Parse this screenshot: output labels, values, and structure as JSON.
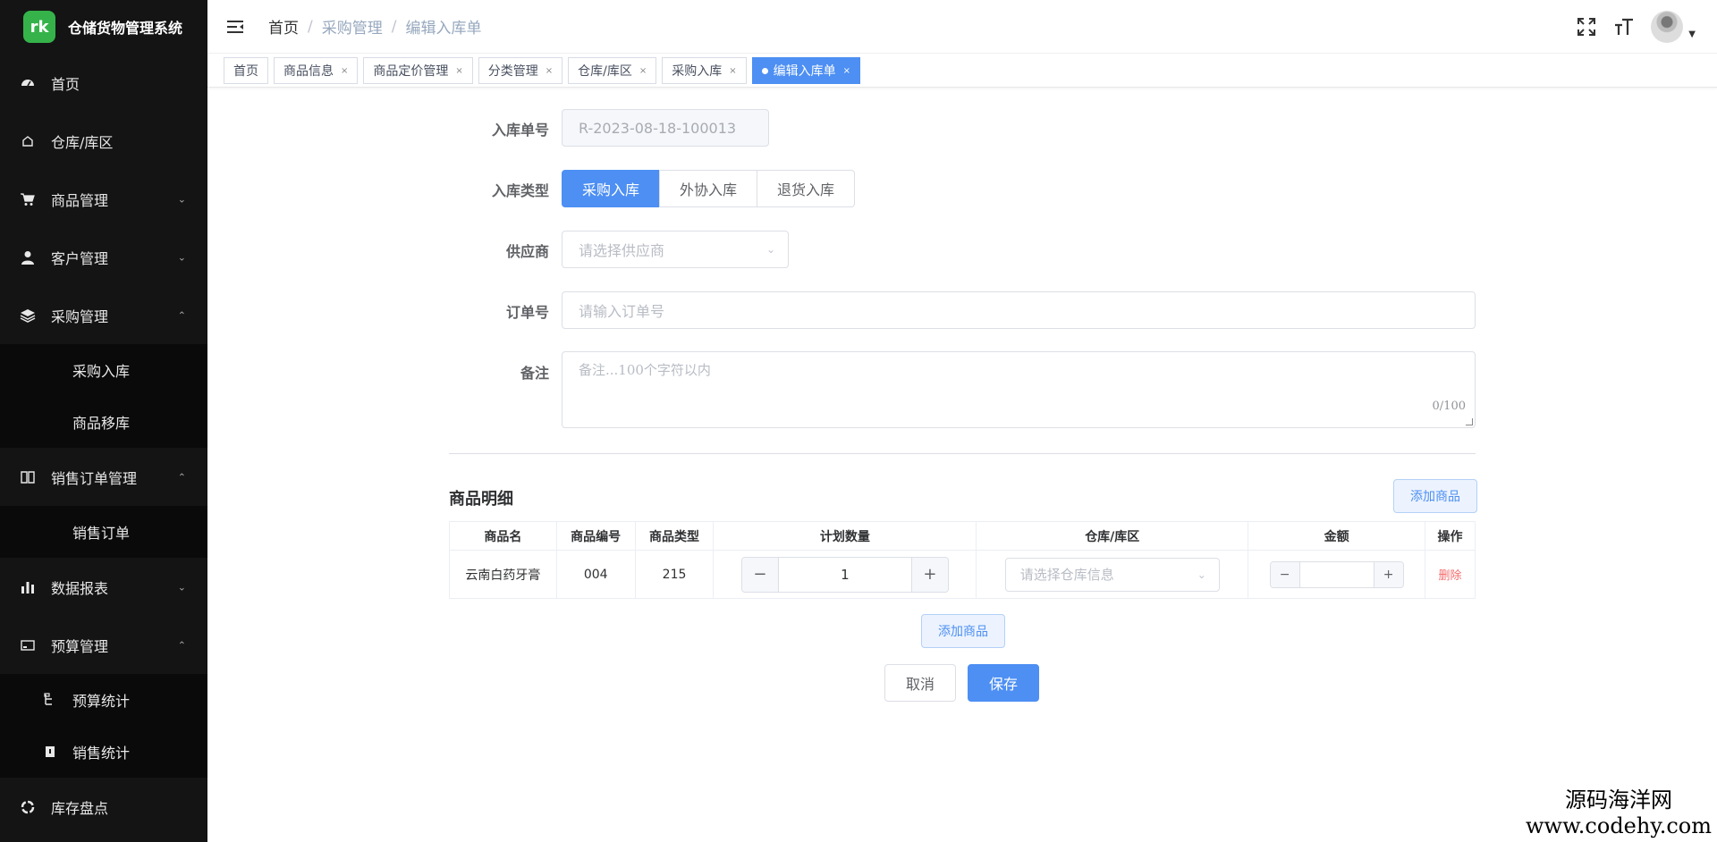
{
  "app": {
    "title": "仓储货物管理系统",
    "logo_text": "rk"
  },
  "sidebar": {
    "items": [
      {
        "label": "首页",
        "icon": "dashboard-icon"
      },
      {
        "label": "仓库/库区",
        "icon": "warehouse-icon"
      },
      {
        "label": "商品管理",
        "icon": "cart-icon",
        "chevron": "down"
      },
      {
        "label": "客户管理",
        "icon": "user-icon",
        "chevron": "down"
      },
      {
        "label": "采购管理",
        "icon": "layers-icon",
        "chevron": "up",
        "children": [
          {
            "label": "采购入库"
          },
          {
            "label": "商品移库"
          }
        ]
      },
      {
        "label": "销售订单管理",
        "icon": "book-icon",
        "chevron": "up",
        "children": [
          {
            "label": "销售订单"
          }
        ]
      },
      {
        "label": "数据报表",
        "icon": "bar-chart-icon",
        "chevron": "down"
      },
      {
        "label": "预算管理",
        "icon": "card-icon",
        "chevron": "up",
        "children": [
          {
            "label": "预算统计",
            "icon": "tree-icon"
          },
          {
            "label": "销售统计",
            "icon": "doc-icon"
          }
        ]
      },
      {
        "label": "库存盘点",
        "icon": "inventory-icon"
      }
    ]
  },
  "header": {
    "breadcrumb": [
      "首页",
      "采购管理",
      "编辑入库单"
    ]
  },
  "tags": [
    {
      "label": "首页",
      "closable": false
    },
    {
      "label": "商品信息",
      "closable": true
    },
    {
      "label": "商品定价管理",
      "closable": true
    },
    {
      "label": "分类管理",
      "closable": true
    },
    {
      "label": "仓库/库区",
      "closable": true
    },
    {
      "label": "采购入库",
      "closable": true
    },
    {
      "label": "编辑入库单",
      "closable": true,
      "active": true
    }
  ],
  "form": {
    "order_no_label": "入库单号",
    "order_no_value": "R-2023-08-18-100013",
    "type_label": "入库类型",
    "type_options": [
      "采购入库",
      "外协入库",
      "退货入库"
    ],
    "type_selected": "采购入库",
    "supplier_label": "供应商",
    "supplier_placeholder": "请选择供应商",
    "order_label": "订单号",
    "order_placeholder": "请输入订单号",
    "remark_label": "备注",
    "remark_placeholder": "备注...100个字符以内",
    "remark_counter": "0/100"
  },
  "items_section": {
    "title": "商品明细",
    "add_button": "添加商品",
    "columns": [
      "商品名",
      "商品编号",
      "商品类型",
      "计划数量",
      "仓库/库区",
      "金额",
      "操作"
    ],
    "rows": [
      {
        "name": "云南白药牙膏",
        "code": "004",
        "type": "215",
        "qty": "1",
        "warehouse_placeholder": "请选择仓库信息",
        "amount": "",
        "action": "删除"
      }
    ],
    "add_button_bottom": "添加商品"
  },
  "actions": {
    "cancel": "取消",
    "save": "保存"
  },
  "watermark": {
    "line1": "源码海洋网",
    "line2": "www.codehy.com"
  },
  "colors": {
    "primary": "#4d8ff3",
    "sidebar_bg": "#141414",
    "danger": "#f56c6c"
  }
}
